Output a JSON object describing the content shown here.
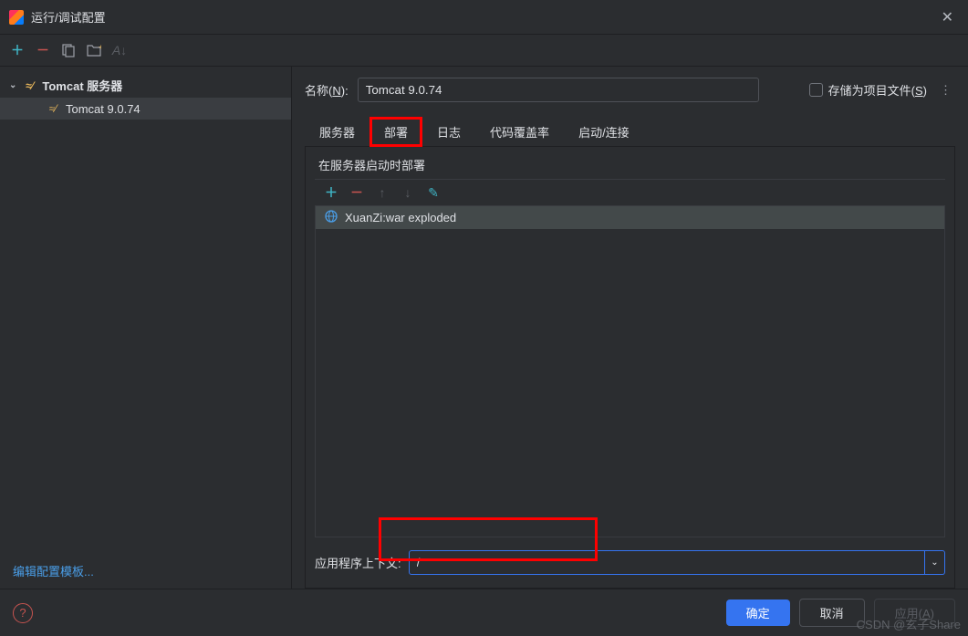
{
  "dialog": {
    "title": "运行/调试配置"
  },
  "sidebar": {
    "parent": {
      "label": "Tomcat 服务器"
    },
    "child": {
      "label": "Tomcat 9.0.74"
    },
    "edit_templates": "编辑配置模板..."
  },
  "main": {
    "name_label_prefix": "名称(",
    "name_label_key": "N",
    "name_label_suffix": "):",
    "name_value": "Tomcat 9.0.74",
    "store_prefix": "存储为项目文件(",
    "store_key": "S",
    "store_suffix": ")",
    "tabs": {
      "server": "服务器",
      "deployment": "部署",
      "logs": "日志",
      "coverage": "代码覆盖率",
      "startup": "启动/连接"
    },
    "deploy_section_label": "在服务器启动时部署",
    "artifact": "XuanZi:war exploded",
    "context_label": "应用程序上下文:",
    "context_value": "/"
  },
  "buttons": {
    "ok": "确定",
    "cancel": "取消",
    "apply_prefix": "应用(",
    "apply_key": "A",
    "apply_suffix": ")"
  },
  "watermark": "CSDN @玄子Share"
}
